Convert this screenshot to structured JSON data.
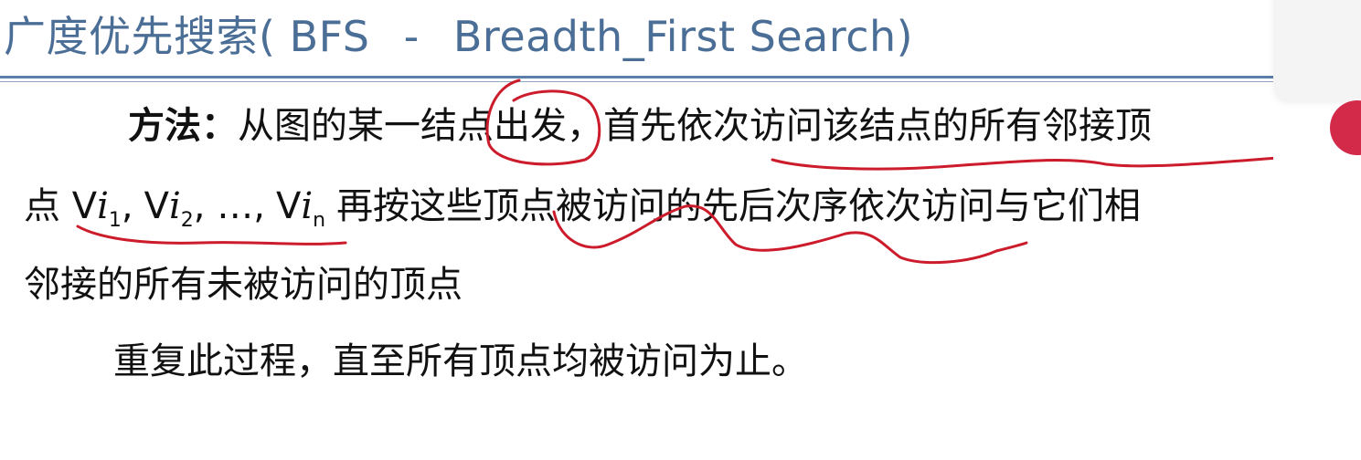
{
  "title": {
    "chinese": "广度优先搜索(",
    "abbr": "BFS",
    "separator": "-",
    "english": "Breadth_First Search)"
  },
  "content": {
    "method_label": "方法",
    "method_colon": "：",
    "line1_text": "从图的某一结点出发，首先依次访问该结点的所有邻接顶",
    "line2_prefix": "点",
    "vertices": [
      {
        "v": "V",
        "i": "i",
        "sub": "1",
        "sep": ","
      },
      {
        "v": "V",
        "i": "i",
        "sub": "2",
        "sep": ", …,"
      },
      {
        "v": "V",
        "i": "i",
        "sub": "n",
        "sep": ""
      }
    ],
    "line2_text": "再按这些顶点被访问的先后次序依次访问与它们相",
    "line3_text": "邻接的所有未被访问的顶点",
    "line4_text": "重复此过程，直至所有顶点均被访问为止。"
  },
  "colors": {
    "title": "#4b6e96",
    "rule": "#5b7fa8",
    "text": "#111111",
    "annotation": "#cc1b2b"
  }
}
